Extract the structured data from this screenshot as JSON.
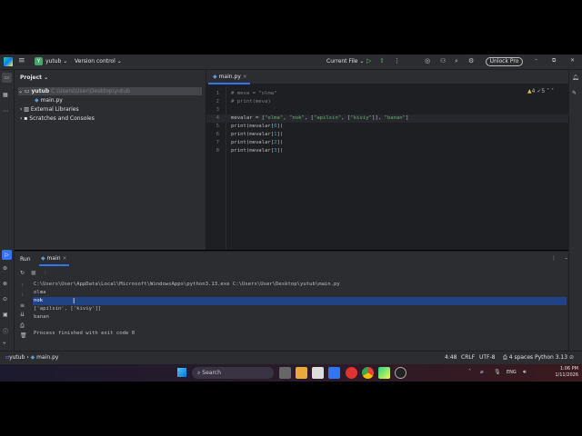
{
  "titlebar": {
    "project": "yutub",
    "project_initial": "Y",
    "vcs": "Version control",
    "run_config": "Current File",
    "unlock": "Unlock Pro"
  },
  "project_panel": {
    "title": "Project",
    "root": "yutub",
    "root_path": "C:\\Users\\User\\Desktop\\yutub",
    "file": "main.py",
    "ext_libs": "External Libraries",
    "scratches": "Scratches and Consoles"
  },
  "editor": {
    "tab": "main.py",
    "warnings": "4",
    "weak": "5",
    "lines": [
      {
        "n": "1",
        "parts": [
          [
            "cmt",
            "# meva = \"olma\""
          ]
        ]
      },
      {
        "n": "2",
        "parts": [
          [
            "cmt",
            "# print(meva)"
          ]
        ]
      },
      {
        "n": "3",
        "parts": []
      },
      {
        "n": "4",
        "parts": [
          [
            "",
            "mevalar = ["
          ],
          [
            "str",
            "\"olma\""
          ],
          [
            "",
            ", "
          ],
          [
            "str",
            "\"nok\""
          ],
          [
            "",
            ", ["
          ],
          [
            "str",
            "\"apilsin\""
          ],
          [
            "",
            ", ["
          ],
          [
            "str",
            "\"kiviy\""
          ],
          [
            "",
            "]], "
          ],
          [
            "str",
            "\"banan\""
          ],
          [
            "",
            "]"
          ]
        ]
      },
      {
        "n": "5",
        "parts": [
          [
            "",
            "print(mevalar["
          ],
          [
            "num",
            "0"
          ],
          [
            "",
            "])"
          ]
        ]
      },
      {
        "n": "6",
        "parts": [
          [
            "",
            "print(mevalar["
          ],
          [
            "num",
            "1"
          ],
          [
            "",
            "])"
          ]
        ]
      },
      {
        "n": "7",
        "parts": [
          [
            "",
            "print(mevalar["
          ],
          [
            "num",
            "2"
          ],
          [
            "",
            "])"
          ]
        ]
      },
      {
        "n": "8",
        "parts": [
          [
            "",
            "print(mevalar["
          ],
          [
            "num",
            "3"
          ],
          [
            "",
            "])"
          ]
        ]
      }
    ]
  },
  "run": {
    "title": "Run",
    "tab": "main",
    "output": [
      "C:\\Users\\User\\AppData\\Local\\Microsoft\\WindowsApps\\python3.13.exe C:\\Users\\User\\Desktop\\yutub\\main.py",
      "olma",
      "nok",
      "['apilsin', ['kiviy']]",
      "banan",
      "",
      "Process finished with exit code 0"
    ]
  },
  "status": {
    "crumb_project": "yutub",
    "crumb_file": "main.py",
    "position": "4:48",
    "line_sep": "CRLF",
    "encoding": "UTF-8",
    "indent": "4 spaces",
    "interpreter": "Python 3.13"
  },
  "taskbar": {
    "search": "Search",
    "lang": "ENG",
    "time": "1:06 PM",
    "date": "1/11/2026"
  },
  "colors": {
    "accent": "#3574f0",
    "selection": "#214283"
  }
}
